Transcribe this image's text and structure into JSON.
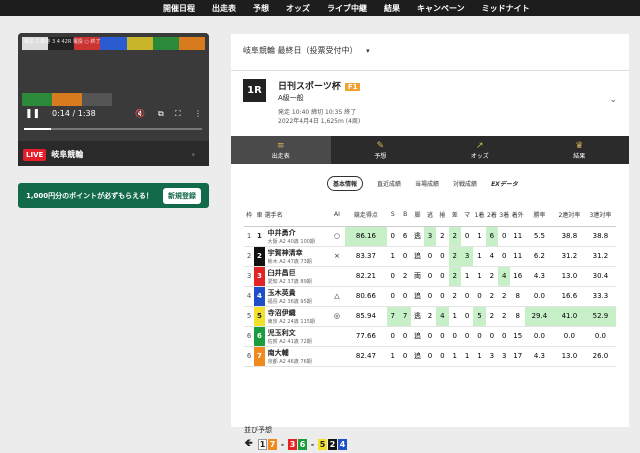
{
  "nav": [
    "開催日程",
    "出走表",
    "予想",
    "オッズ",
    "ライブ中継",
    "結果",
    "キャンペーン",
    "ミッドナイト"
  ],
  "video": {
    "overlay_top": "岐阜 2 車券 3 4 42R 電投 ○ 終了",
    "time": "0:14 / 1:38",
    "progress": 0.15,
    "live_label": "LIVE",
    "title": "岐阜競輪"
  },
  "promo": {
    "text": "1,000円分のポイントが必ずもらえる！",
    "button": "新規登録"
  },
  "day_select": "岐阜競輪 最終日（投票受付中）",
  "race": {
    "no": "1R",
    "title": "日刊スポーツ杯",
    "grade": "F1",
    "class": "A級一般",
    "time": "発走 10:40 締切 10:35 終了",
    "date": "2022年4月4日 1,625m (4周)"
  },
  "tabs": [
    {
      "label": "出走表",
      "icon": "≡"
    },
    {
      "label": "予想",
      "icon": "✎"
    },
    {
      "label": "オッズ",
      "icon": "↗"
    },
    {
      "label": "結果",
      "icon": "♛"
    }
  ],
  "subtabs": [
    "基本情報",
    "直近成績",
    "当場成績",
    "対戦成績",
    "EXデータ"
  ],
  "table": {
    "headers": [
      "枠",
      "車",
      "選手名",
      "AI",
      "競走得点",
      "S",
      "B",
      "脚",
      "逃",
      "捲",
      "差",
      "マ",
      "1着",
      "2着",
      "3着",
      "着外",
      "勝率",
      "2連対率",
      "3連対率"
    ],
    "rows": [
      {
        "frame": "1",
        "car": "1",
        "color": "#ffffff",
        "text": "#222",
        "name": "中井勇介",
        "sub": "大阪 A2 40歳 100期",
        "ai": "○",
        "score": "86.16",
        "s": "0",
        "b": "6",
        "leg": "逃",
        "nige": "3",
        "makuri": "2",
        "sashi": "2",
        "ma": "0",
        "c1": "1",
        "c2": "6",
        "c3": "0",
        "out": "11",
        "win": "5.5",
        "r2": "38.8",
        "r3": "38.8",
        "hl": [
          "score",
          "nige",
          "sashi",
          "c2"
        ]
      },
      {
        "frame": "2",
        "car": "2",
        "color": "#111111",
        "text": "#fff",
        "name": "宇賀神清幸",
        "sub": "栃木 A2 47歳 73期",
        "ai": "×",
        "score": "83.37",
        "s": "1",
        "b": "0",
        "leg": "追",
        "nige": "0",
        "makuri": "0",
        "sashi": "2",
        "ma": "3",
        "c1": "1",
        "c2": "4",
        "c3": "0",
        "out": "11",
        "win": "6.2",
        "r2": "31.2",
        "r3": "31.2",
        "hl": [
          "sashi",
          "ma"
        ]
      },
      {
        "frame": "3",
        "car": "3",
        "color": "#e22323",
        "text": "#fff",
        "name": "臼井昌巨",
        "sub": "愛知 A2 37歳 89期",
        "ai": "",
        "score": "82.21",
        "s": "0",
        "b": "2",
        "leg": "両",
        "nige": "0",
        "makuri": "0",
        "sashi": "2",
        "ma": "1",
        "c1": "1",
        "c2": "2",
        "c3": "4",
        "out": "16",
        "win": "4.3",
        "r2": "13.0",
        "r3": "30.4",
        "hl": [
          "sashi",
          "c3"
        ]
      },
      {
        "frame": "4",
        "car": "4",
        "color": "#1e4fc8",
        "text": "#fff",
        "name": "玉木英貴",
        "sub": "福島 A2 36歳 95期",
        "ai": "△",
        "score": "80.66",
        "s": "0",
        "b": "0",
        "leg": "追",
        "nige": "0",
        "makuri": "0",
        "sashi": "2",
        "ma": "0",
        "c1": "0",
        "c2": "2",
        "c3": "2",
        "out": "8",
        "win": "0.0",
        "r2": "16.6",
        "r3": "33.3",
        "hl": []
      },
      {
        "frame": "5",
        "car": "5",
        "color": "#f2e02b",
        "text": "#222",
        "name": "寺沼伊織",
        "sub": "東京 A2 24歳 115期",
        "ai": "◎",
        "score": "85.94",
        "s": "7",
        "b": "7",
        "leg": "逃",
        "nige": "2",
        "makuri": "4",
        "sashi": "1",
        "ma": "0",
        "c1": "5",
        "c2": "2",
        "c3": "2",
        "out": "8",
        "win": "29.4",
        "r2": "41.0",
        "r3": "52.9",
        "hl": [
          "s",
          "b",
          "makuri",
          "c1",
          "win",
          "r2",
          "r3"
        ]
      },
      {
        "frame": "6",
        "car": "6",
        "color": "#1a9b3c",
        "text": "#fff",
        "name": "児玉利文",
        "sub": "佐賀 A2 41歳 72期",
        "ai": "",
        "score": "77.66",
        "s": "0",
        "b": "0",
        "leg": "追",
        "nige": "0",
        "makuri": "0",
        "sashi": "0",
        "ma": "0",
        "c1": "0",
        "c2": "0",
        "c3": "0",
        "out": "15",
        "win": "0.0",
        "r2": "0.0",
        "r3": "0.0",
        "hl": []
      },
      {
        "frame": "6",
        "car": "7",
        "color": "#f08a1e",
        "text": "#fff",
        "name": "南大輔",
        "sub": "京都 A2 46歳 76期",
        "ai": "",
        "score": "82.47",
        "s": "1",
        "b": "0",
        "leg": "追",
        "nige": "0",
        "makuri": "0",
        "sashi": "1",
        "ma": "1",
        "c1": "1",
        "c2": "3",
        "c3": "3",
        "out": "17",
        "win": "4.3",
        "r2": "13.0",
        "r3": "26.0",
        "hl": []
      }
    ]
  },
  "prediction": {
    "label": "並び予想",
    "items": [
      {
        "n": "1",
        "bg": "#ffffff",
        "fg": "#222"
      },
      {
        "n": "7",
        "bg": "#f08a1e",
        "fg": "#fff"
      },
      {
        "n": "-",
        "bg": "transparent",
        "fg": "#222"
      },
      {
        "n": "3",
        "bg": "#e22323",
        "fg": "#fff"
      },
      {
        "n": "6",
        "bg": "#1a9b3c",
        "fg": "#fff"
      },
      {
        "n": "-",
        "bg": "transparent",
        "fg": "#222"
      },
      {
        "n": "5",
        "bg": "#f2e02b",
        "fg": "#222"
      },
      {
        "n": "2",
        "bg": "#111111",
        "fg": "#fff"
      },
      {
        "n": "4",
        "bg": "#1e4fc8",
        "fg": "#fff"
      }
    ]
  }
}
